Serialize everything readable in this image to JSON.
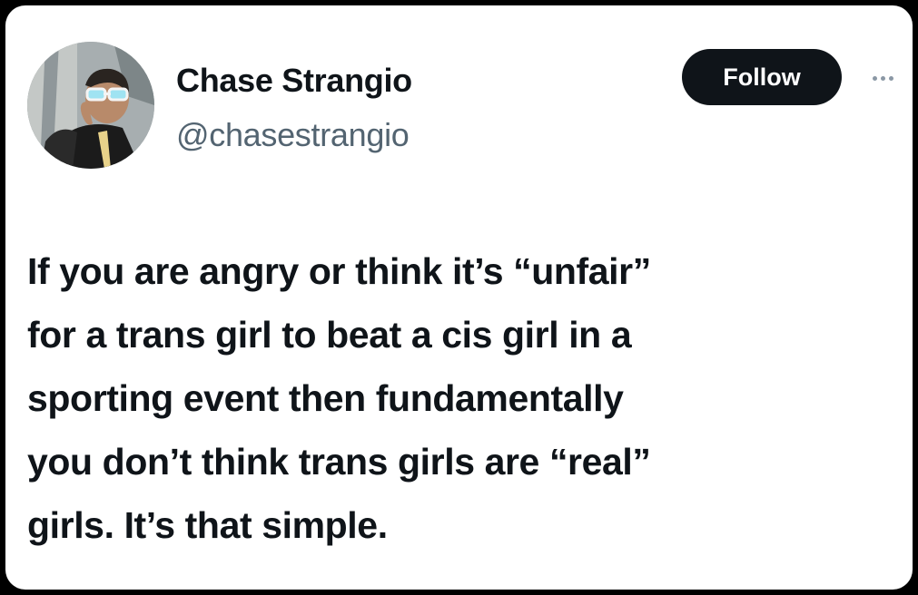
{
  "tweet": {
    "author": {
      "display_name": "Chase Strangio",
      "handle": "@chasestrangio",
      "avatar_icon": "profile-photo"
    },
    "follow_label": "Follow",
    "more_icon": "ellipsis-icon",
    "text_lines": [
      "If you are angry or think it’s “unfair”",
      "for a trans girl to beat a cis girl in a",
      "sporting event then fundamentally",
      "you don’t think trans girls are “real”",
      "girls. It’s that simple."
    ]
  },
  "colors": {
    "background": "#000000",
    "card": "#ffffff",
    "text_primary": "#0f1419",
    "text_secondary": "#536471",
    "button_bg": "#0f1419",
    "button_text": "#ffffff"
  }
}
